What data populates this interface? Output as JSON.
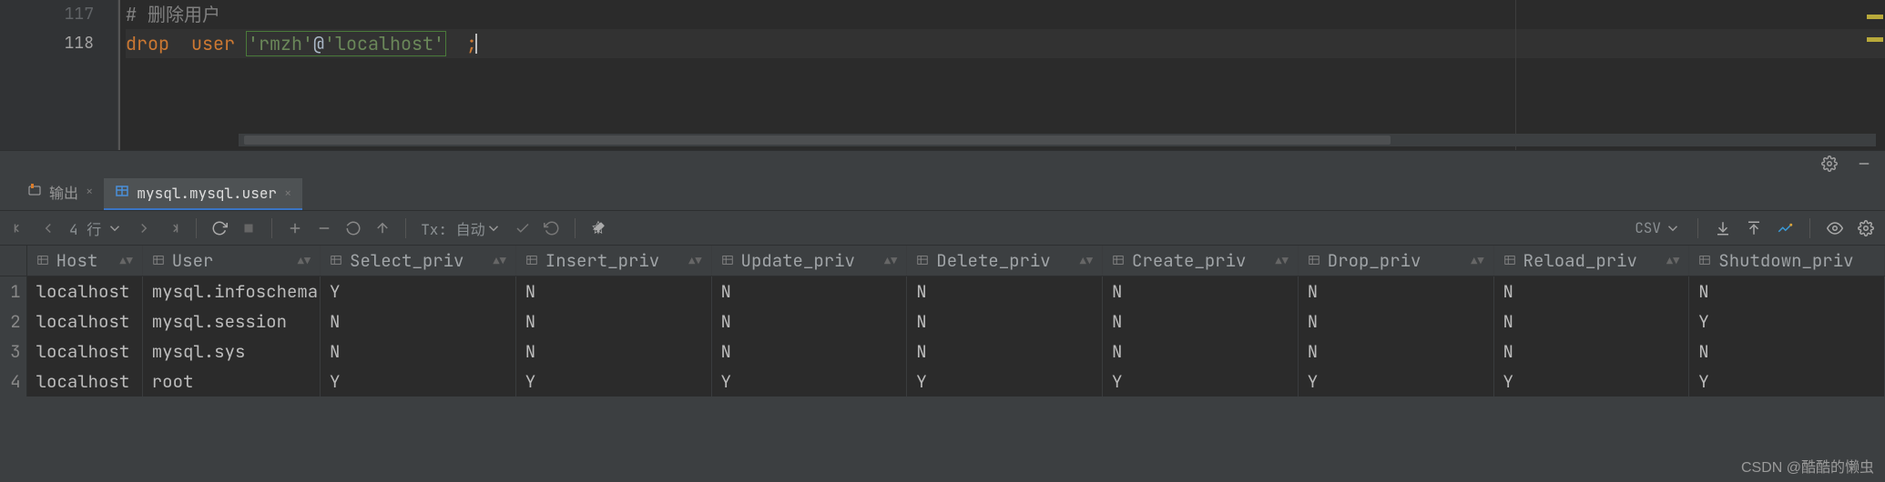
{
  "editor": {
    "lines": [
      {
        "num": "117",
        "type": "comment",
        "text": "# 删除用户"
      },
      {
        "num": "118",
        "type": "sql",
        "kw1": "drop",
        "kw2": "user",
        "str1": "'rmzh'",
        "at": "@",
        "str2": "'localhost'",
        "tail": ";"
      }
    ]
  },
  "toolwin": {
    "tabs": {
      "output": "输出",
      "active": "mysql.mysql.user"
    },
    "toolbar": {
      "rows_label": "4 行",
      "tx_label": "Tx: 自动",
      "csv_label": "CSV"
    },
    "columns": [
      {
        "key": "row",
        "label": ""
      },
      {
        "key": "Host",
        "label": "Host"
      },
      {
        "key": "User",
        "label": "User"
      },
      {
        "key": "Select_priv",
        "label": "Select_priv"
      },
      {
        "key": "Insert_priv",
        "label": "Insert_priv"
      },
      {
        "key": "Update_priv",
        "label": "Update_priv"
      },
      {
        "key": "Delete_priv",
        "label": "Delete_priv"
      },
      {
        "key": "Create_priv",
        "label": "Create_priv"
      },
      {
        "key": "Drop_priv",
        "label": "Drop_priv"
      },
      {
        "key": "Reload_priv",
        "label": "Reload_priv"
      },
      {
        "key": "Shutdown_priv",
        "label": "Shutdown_priv"
      }
    ],
    "rows": [
      {
        "n": "1",
        "Host": "localhost",
        "User": "mysql.infoschema",
        "Select_priv": "Y",
        "Insert_priv": "N",
        "Update_priv": "N",
        "Delete_priv": "N",
        "Create_priv": "N",
        "Drop_priv": "N",
        "Reload_priv": "N",
        "Shutdown_priv": "N"
      },
      {
        "n": "2",
        "Host": "localhost",
        "User": "mysql.session",
        "Select_priv": "N",
        "Insert_priv": "N",
        "Update_priv": "N",
        "Delete_priv": "N",
        "Create_priv": "N",
        "Drop_priv": "N",
        "Reload_priv": "N",
        "Shutdown_priv": "Y"
      },
      {
        "n": "3",
        "Host": "localhost",
        "User": "mysql.sys",
        "Select_priv": "N",
        "Insert_priv": "N",
        "Update_priv": "N",
        "Delete_priv": "N",
        "Create_priv": "N",
        "Drop_priv": "N",
        "Reload_priv": "N",
        "Shutdown_priv": "N"
      },
      {
        "n": "4",
        "Host": "localhost",
        "User": "root",
        "Select_priv": "Y",
        "Insert_priv": "Y",
        "Update_priv": "Y",
        "Delete_priv": "Y",
        "Create_priv": "Y",
        "Drop_priv": "Y",
        "Reload_priv": "Y",
        "Shutdown_priv": "Y"
      }
    ]
  },
  "watermark": "CSDN @酷酷的懒虫"
}
